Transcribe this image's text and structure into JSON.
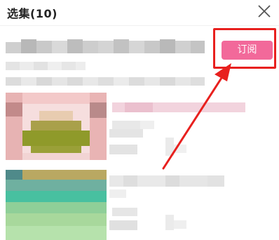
{
  "header": {
    "title": "选集(10)"
  },
  "actions": {
    "subscribe_label": "订阅"
  },
  "colors": {
    "accent": "#f2699a",
    "annotation": "#e8201e"
  }
}
